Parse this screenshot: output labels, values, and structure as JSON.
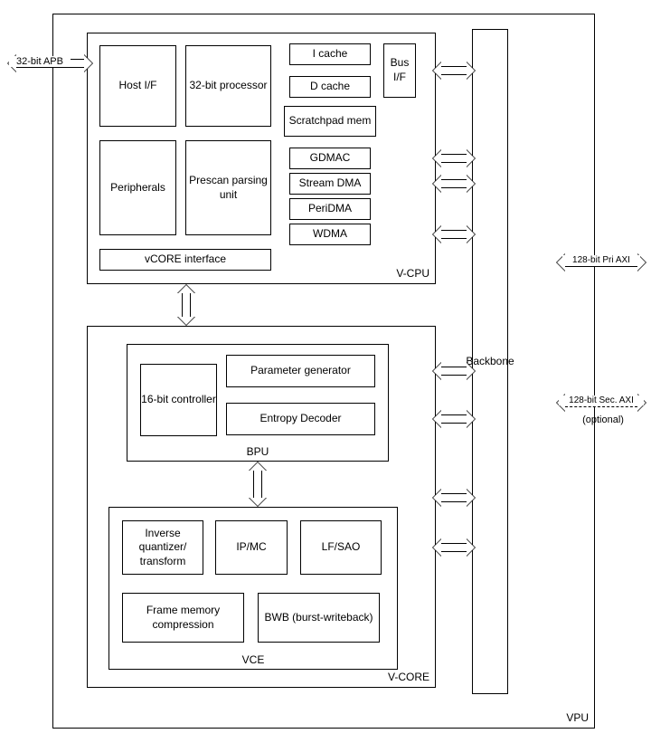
{
  "outer": {
    "label": "VPU"
  },
  "backbone": {
    "label": "Backbone"
  },
  "vcpu": {
    "label": "V-CPU",
    "host_if": "Host I/F",
    "processor": "32-bit processor",
    "peripherals": "Peripherals",
    "prescan": "Prescan parsing unit",
    "vcore_interface": "vCORE interface",
    "i_cache": "I cache",
    "d_cache": "D cache",
    "scratchpad": "Scratchpad mem",
    "gdmac": "GDMAC",
    "stream_dma": "Stream DMA",
    "peridma": "PeriDMA",
    "wdma": "WDMA",
    "bus_if": "Bus I/F"
  },
  "vcore": {
    "label": "V-CORE",
    "bpu": {
      "label": "BPU",
      "controller": "16-bit controller",
      "param_gen": "Parameter generator",
      "entropy": "Entropy Decoder"
    },
    "vce": {
      "label": "VCE",
      "inv_quant": "Inverse quantizer/ transform",
      "ipmc": "IP/MC",
      "lfsao": "LF/SAO",
      "fmc": "Frame memory compression",
      "bwb": "BWB (burst-writeback)"
    }
  },
  "ext": {
    "apb": "32-bit APB",
    "pri_axi": "128-bit Pri AXI",
    "sec_axi": "128-bit Sec. AXI",
    "sec_axi_note": "(optional)"
  }
}
